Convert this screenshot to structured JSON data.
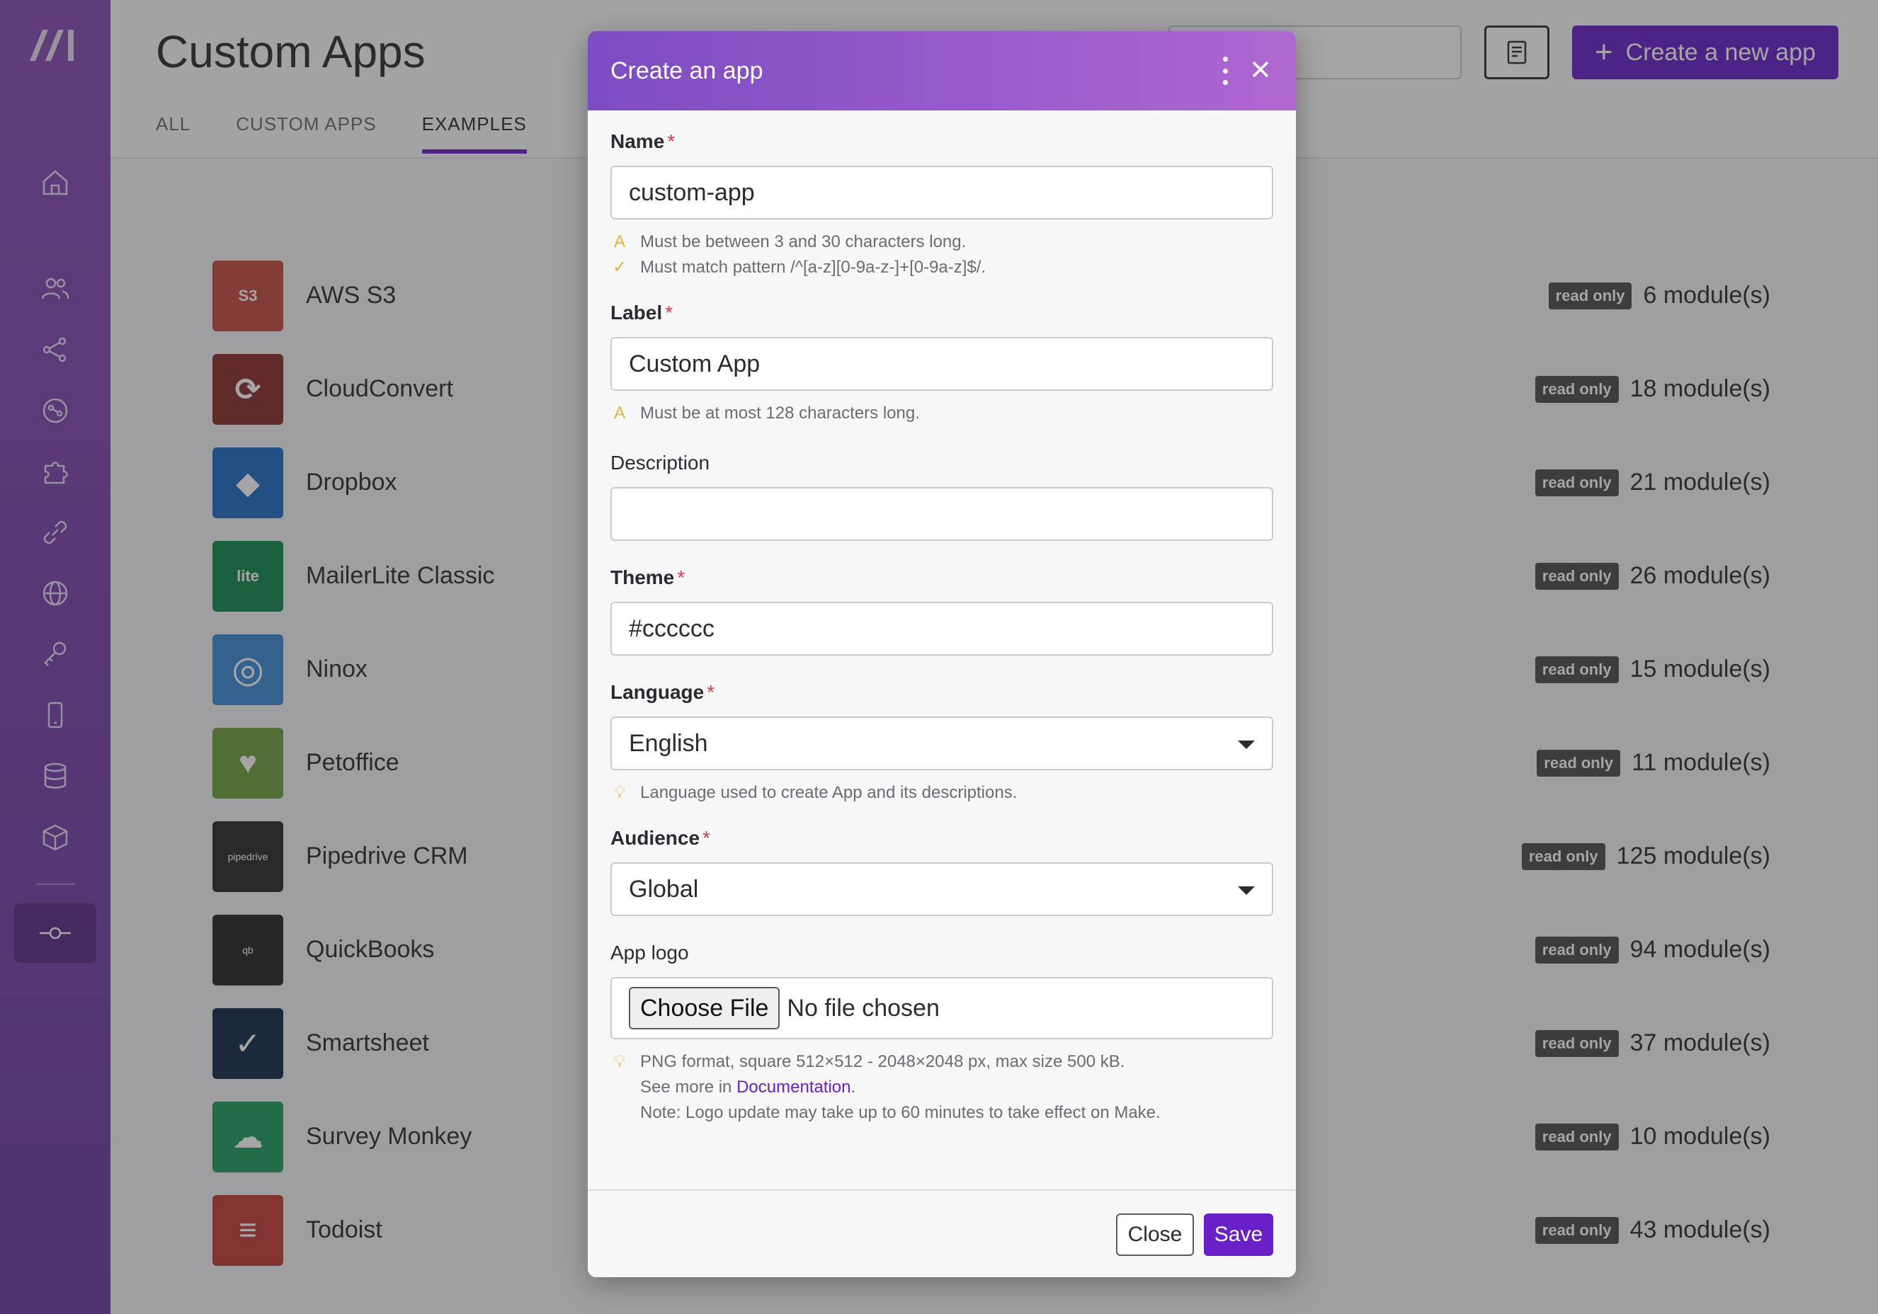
{
  "app": {
    "title": "Custom Apps",
    "tabs": [
      {
        "label": "ALL",
        "active": false
      },
      {
        "label": "CUSTOM APPS",
        "active": false
      },
      {
        "label": "EXAMPLES",
        "active": true
      }
    ],
    "create_button_label": "Create a new app"
  },
  "sidebar": {
    "items": [
      "home-icon",
      "users-icon",
      "share-icon",
      "scenario-icon",
      "puzzle-icon",
      "link-icon",
      "globe-icon",
      "key-icon",
      "device-icon",
      "database-icon",
      "box-icon",
      "custom-apps-icon"
    ]
  },
  "apps": [
    {
      "name": "AWS S3",
      "badge": "read only",
      "modules": "6 module(s)",
      "color": "#c5493f",
      "logo_text": "S3"
    },
    {
      "name": "CloudConvert",
      "badge": "read only",
      "modules": "18 module(s)",
      "color": "#8b2e2e",
      "logo_text": "⟳"
    },
    {
      "name": "Dropbox",
      "badge": "read only",
      "modules": "21 module(s)",
      "color": "#1d6fc4",
      "logo_text": "◆"
    },
    {
      "name": "MailerLite Classic",
      "badge": "read only",
      "modules": "26 module(s)",
      "color": "#138a4c",
      "logo_text": "lite"
    },
    {
      "name": "Ninox",
      "badge": "read only",
      "modules": "15 module(s)",
      "color": "#3e8ad6",
      "logo_text": "◎"
    },
    {
      "name": "Petoffice",
      "badge": "read only",
      "modules": "11 module(s)",
      "color": "#6ea03c",
      "logo_text": "♥"
    },
    {
      "name": "Pipedrive CRM",
      "badge": "read only",
      "modules": "125 module(s)",
      "color": "#2a2b30",
      "logo_text": "pipedrive"
    },
    {
      "name": "QuickBooks",
      "badge": "read only",
      "modules": "94 module(s)",
      "color": "#262629",
      "logo_text": "qb"
    },
    {
      "name": "Smartsheet",
      "badge": "read only",
      "modules": "37 module(s)",
      "color": "#142a4a",
      "logo_text": "✓"
    },
    {
      "name": "Survey Monkey",
      "badge": "read only",
      "modules": "10 module(s)",
      "color": "#1f9e5e",
      "logo_text": "☁"
    },
    {
      "name": "Todoist",
      "badge": "read only",
      "modules": "43 module(s)",
      "color": "#c23d34",
      "logo_text": "≡"
    }
  ],
  "modal": {
    "title": "Create an app",
    "name": {
      "label": "Name",
      "value": "custom-app",
      "hints": [
        "Must be between 3 and 30 characters long.",
        "Must match pattern /^[a-z][0-9a-z-]+[0-9a-z]$/."
      ]
    },
    "label": {
      "label": "Label",
      "value": "Custom App",
      "hint": "Must be at most 128 characters long."
    },
    "description": {
      "label": "Description",
      "value": ""
    },
    "theme": {
      "label": "Theme",
      "value": "#cccccc"
    },
    "language": {
      "label": "Language",
      "value": "English",
      "hint": "Language used to create App and its descriptions."
    },
    "audience": {
      "label": "Audience",
      "value": "Global"
    },
    "app_logo": {
      "label": "App logo",
      "choose_label": "Choose File",
      "status": "No file chosen",
      "hint_line1": "PNG format, square 512×512 - 2048×2048 px, max size 500 kB.",
      "hint_see_more": "See more in",
      "hint_link": "Documentation",
      "hint_period": ".",
      "hint_line3": "Note: Logo update may take up to 60 minutes to take effect on Make."
    },
    "required_mark": "*",
    "close_label": "Close",
    "save_label": "Save"
  }
}
